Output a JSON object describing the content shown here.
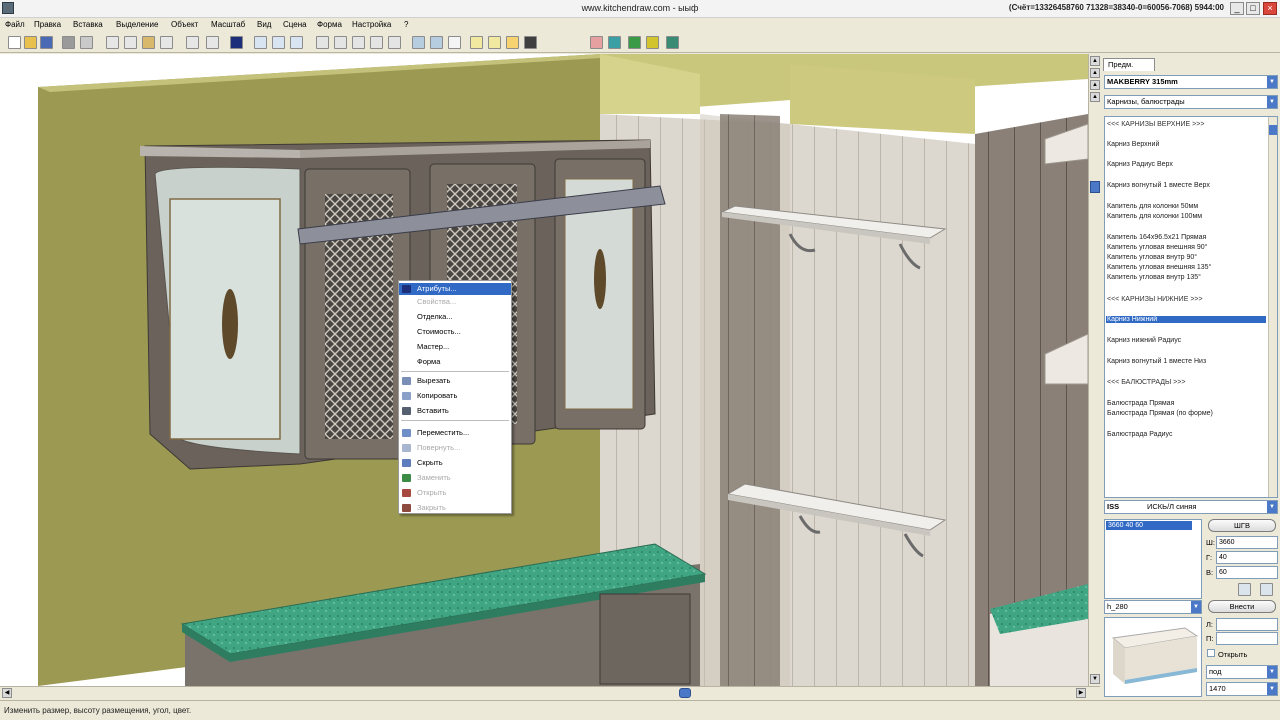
{
  "window": {
    "title": "www.kitchendraw.com - ыыф",
    "licence": "(Счёт=13326458760 71328=38340-0=60056-7068) 5944:00",
    "min": "_",
    "max": "□",
    "close": "×"
  },
  "menu": [
    "Файл",
    "Правка",
    "Вставка",
    "Выделение",
    "Объект",
    "Масштаб",
    "Вид",
    "Сцена",
    "Форма",
    "Настройка",
    "?"
  ],
  "context_menu": {
    "items": [
      {
        "label": "Атрибуты...",
        "state": "selected"
      },
      {
        "label": "Свойства...",
        "state": "disabled"
      },
      {
        "label": "Отделка...",
        "state": "normal"
      },
      {
        "label": "Стоимость...",
        "state": "normal"
      },
      {
        "label": "Мастер...",
        "state": "normal"
      },
      {
        "label": "Форма",
        "state": "normal"
      },
      {
        "label": "Вырезать",
        "state": "normal"
      },
      {
        "label": "Копировать",
        "state": "normal"
      },
      {
        "label": "Вставить",
        "state": "normal"
      },
      {
        "label": "Переместить...",
        "state": "normal"
      },
      {
        "label": "Повернуть...",
        "state": "disabled"
      },
      {
        "label": "Скрыть",
        "state": "normal"
      },
      {
        "label": "Заменить",
        "state": "disabled"
      },
      {
        "label": "Открыть",
        "state": "disabled"
      },
      {
        "label": "Закрыть",
        "state": "disabled"
      }
    ]
  },
  "status": {
    "text": "Изменить размер, высоту размещения, угол, цвет."
  },
  "panel": {
    "tab": "Предм.",
    "catalog": "MAKBERRY 315mm",
    "family": "Карнизы, балюстрады",
    "items": [
      {
        "label": "<<< КАРНИЗЫ ВЕРХНИЕ >>>",
        "kind": "header"
      },
      {
        "label": "Карниз Верхний",
        "kind": "item"
      },
      {
        "label": "Карниз Радиус Верх",
        "kind": "item"
      },
      {
        "label": "Карниз вогнутый 1 вместе Верх",
        "kind": "item"
      },
      {
        "label": "Капитель для колонки 50мм",
        "kind": "item"
      },
      {
        "label": "Капитель для колонки 100мм",
        "kind": "item"
      },
      {
        "label": "Капитель 164x96.5x21 Прямая",
        "kind": "item"
      },
      {
        "label": "Капитель угловая внешняя 90°",
        "kind": "item"
      },
      {
        "label": "Капитель угловая внутр 90°",
        "kind": "item"
      },
      {
        "label": "Капитель угловая внешняя 135°",
        "kind": "item"
      },
      {
        "label": "Капитель угловая внутр 135°",
        "kind": "item"
      },
      {
        "label": "<<< КАРНИЗЫ НИЖНИЕ >>>",
        "kind": "header"
      },
      {
        "label": "Карниз Нижний",
        "kind": "selected"
      },
      {
        "label": "Карниз нижний Радиус",
        "kind": "item"
      },
      {
        "label": "Карниз вогнутый 1 вместе Низ",
        "kind": "item"
      },
      {
        "label": "<<< БАЛЮСТРАДЫ >>>",
        "kind": "header"
      },
      {
        "label": "Балюстрада Прямая",
        "kind": "item"
      },
      {
        "label": "Балюстрада Прямая (по форме)",
        "kind": "item"
      },
      {
        "label": "Балюстрада Радиус",
        "kind": "item"
      }
    ],
    "finish_code": "ISS",
    "finish_name": "ИСКЬ/Л синяя",
    "sizes_selected": "3660  40  60",
    "size_button": "ШГВ",
    "w_label": "Ш:",
    "w_value": "3660",
    "g_label": "Г:",
    "g_value": "40",
    "v_label": "В:",
    "v_value": "60",
    "variant": "h_280",
    "insert_button": "Внести",
    "l_label": "Л:",
    "p_label": "П:",
    "open_label": "Открыть",
    "under_value": "под",
    "height_value": "1470"
  }
}
